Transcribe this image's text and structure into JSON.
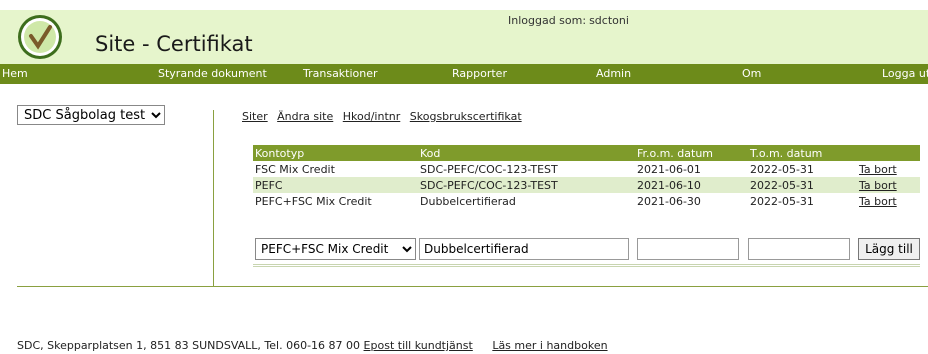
{
  "header": {
    "title": "Site - Certifikat",
    "login_label": "Inloggad som:",
    "login_user": "sdctoni",
    "logo_icon": "checkmark-badge-icon",
    "accent": "#6d8b1a",
    "background": "#e6f5cc"
  },
  "nav": {
    "items": [
      {
        "label": "Hem"
      },
      {
        "label": "Styrande dokument"
      },
      {
        "label": "Transaktioner"
      },
      {
        "label": "Rapporter"
      },
      {
        "label": "Admin"
      },
      {
        "label": "Om"
      },
      {
        "label": "Logga ut"
      }
    ]
  },
  "sidebar": {
    "selected_site": "SDC Sågbolag test"
  },
  "tabs": [
    {
      "label": "Siter"
    },
    {
      "label": "Ändra site"
    },
    {
      "label": "Hkod/intnr"
    },
    {
      "label": "Skogsbrukscertifikat"
    }
  ],
  "table": {
    "headers": [
      "Kontotyp",
      "Kod",
      "Fr.o.m. datum",
      "T.o.m. datum"
    ],
    "rows": [
      {
        "kontotyp": "FSC Mix Credit",
        "kod": "SDC-PEFC/COC-123-TEST",
        "from": "2021-06-01",
        "tom": "2022-05-31",
        "action": "Ta bort"
      },
      {
        "kontotyp": "PEFC",
        "kod": "SDC-PEFC/COC-123-TEST",
        "from": "2021-06-10",
        "tom": "2022-05-31",
        "action": "Ta bort"
      },
      {
        "kontotyp": "PEFC+FSC Mix Credit",
        "kod": "Dubbelcertifierad",
        "from": "2021-06-30",
        "tom": "2022-05-31",
        "action": "Ta bort"
      }
    ]
  },
  "add_form": {
    "kontotyp_value": "PEFC+FSC Mix Credit",
    "kod_value": "Dubbelcertifierad",
    "from_value": "",
    "tom_value": "",
    "button_label": "Lägg till"
  },
  "footer": {
    "address": "SDC, Skepparplatsen 1, 851 83 SUNDSVALL, Tel. 060-16 87 00",
    "email_link": "Epost till kundtjänst",
    "manual_link": "Läs mer i handboken"
  }
}
